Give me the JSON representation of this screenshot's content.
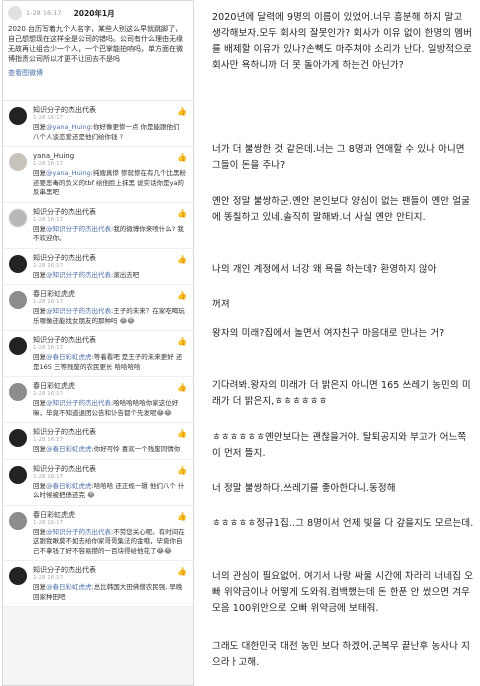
{
  "post": {
    "date": "1-28 16:17",
    "title": "2020年1月",
    "body": "2020 台历写着九个人名字，某些人别这么早就跳脚了，自己想想现在这样全是公司的错吗。公司有什么理由无缘无故再让组合少一个人，一个巴掌能拍响吗，单方面在微博指责公司所以才更不让回去不是吗",
    "more_link": "查看图微博"
  },
  "comments": [
    {
      "name": "知识分子的杰出代表",
      "date": "1-28 16:17",
      "text_prefix": "",
      "mention": "",
      "text": "",
      "reply_prefix": "回复",
      "reply_mention": "@yana_Huing",
      "reply_text": ":你好像更惨一点 你是能跟他们 八个人谈恋爱还是他们给你钱 ?",
      "avatar": "dark"
    },
    {
      "name": "yana_Huing",
      "date": "1-28 16:17",
      "reply_prefix": "回复",
      "reply_mention": "@yana_Huing",
      "reply_text": ":纯嫂真惨 惨就惨在有几个比黑粉还要恶毒的负义的tbf 给他脸上抹黑 说实话你是ya的反串黑吧",
      "avatar": "light"
    },
    {
      "name": "知识分子的杰出代表",
      "date": "1-28 16:17",
      "reply_prefix": "回复",
      "reply_mention": "@知识分子的杰出代表",
      "reply_text": ":我的微博你来喷什么? 我不欢迎你。",
      "avatar": "blur"
    },
    {
      "name": "知识分子的杰出代表",
      "date": "1-28 16:17",
      "reply_prefix": "回复",
      "reply_mention": "@知识分子的杰出代表",
      "reply_text": ":滚出去吧",
      "avatar": "dark"
    },
    {
      "name": "春日彩虹虎虎",
      "date": "1-28 16:17",
      "reply_prefix": "回复",
      "reply_mention": "@知识分子的杰出代表",
      "reply_text": ":王子的未来？在家吃喝玩乐哪像还能找女朋友的那种吗 😂😂",
      "avatar": "mid"
    },
    {
      "name": "知识分子的杰出代表",
      "date": "1-28 16:17",
      "reply_prefix": "回复",
      "reply_mention": "@春日彩虹虎虎",
      "reply_text": ":等着看吧 是王子的未来更好 还是165 三等残废的农民更长 哈哈哈哈",
      "avatar": "dark"
    },
    {
      "name": "春日彩虹虎虎",
      "date": "1-28 16:17",
      "reply_prefix": "回复",
      "reply_mention": "@知识分子的杰出代表",
      "reply_text": ":哈哈哈哈哈你家这位好嘛，毕竟不知道退团公告和讣告都个先发呢😂😂",
      "avatar": "mid"
    },
    {
      "name": "知识分子的杰出代表",
      "date": "1-28 16:17",
      "reply_prefix": "回复",
      "reply_mention": "@春日彩虹虎虎",
      "reply_text": ":你好可怜 喜欢一个残废同情你",
      "avatar": "dark"
    },
    {
      "name": "知识分子的杰出代表",
      "date": "1-28 16:17",
      "reply_prefix": "回复",
      "reply_mention": "@春日彩虹虎虎",
      "reply_text": ":哈哈哈 还正规一辑 他们八个 什么时候被把债还完 😂",
      "avatar": "dark"
    },
    {
      "name": "春日彩虹虎虎",
      "date": "1-28 16:17",
      "reply_prefix": "回复",
      "reply_mention": "@知识分子的杰出代表",
      "reply_text": ":不劳您关心呢。有时间在这跟我瞅莫不如去给你家哥哥集法的金哦，毕竟你自己不拿钱了好不容易攒的一百块得给他花了😂😂",
      "avatar": "mid"
    },
    {
      "name": "知识分子的杰出代表",
      "date": "1-28 16:17",
      "reply_prefix": "回复",
      "reply_mention": "@春日彩虹虎虎",
      "reply_text": ":总比韩国大田佛僧农民强, 早晚回家种田吧",
      "avatar": "dark"
    }
  ],
  "translation": [
    "2020년에 달력에 9명의 이름이 있었어.너무 흥분해 하지 말고 생각해보자.모두 회사의 잘못인가? 회사가 이유 없이 한명의 멤버를 배제할 이유가 있나?손뼉도 마주쳐야 소리가 난다. 일방적으로 회사만 욕하니까 더 못 돌아가게 하는건 아닌가?",
    "너가 더 불쌍한 것 같은데.너는 그 8명과 연애할 수 있나 아니면 그들이 돈을 주나?",
    "옌안 정말 불쌍하군.옌안 본인보다 양심이 없는 팬들이 옌안 얼굴에 똥칠하고 있네.솔직히 말해봐.너 사실 옌안 안티지.",
    "나의 개인 계정에서 너강 왜 욕을 하는데? 환영하지 않아",
    "꺼져",
    "왕자의 미래?집에서 놀면서 여자친구 마음대로 만나는 거?",
    "기다려봐.왕자의 미래가 더 밝은지 아니면 165 쓰레기 농민의 미래가 더 밝은지,ㅎㅎㅎㅎㅎㅎ",
    "ㅎㅎㅎㅎㅎㅎ옌안보다는 괜찮을거야. 탈퇴공지와 부고가 어느쪽이 먼저 뜰지.",
    "너 정말 불쌍하다.쓰레기를 좋아한다니.동정해",
    "ㅎㅎㅎㅎㅎ정규1집..그 8명이서 언제 빚을 다 갚을지도 모르는데.",
    "너의 관심이 필요없어. 여기서 나랑 싸울 시간에 차라리 너네집 오빠 위약금이나 어떻게 도와줘.컴백했는데 돈 한푼 안 썼으면 겨우 모음 100위안으로 오빠 위약금에 보태줘.",
    "그래도 대한민국 대전 농민 보다 하겠어.군복무 끝난후 농사나 지으라ㅏ고해."
  ]
}
